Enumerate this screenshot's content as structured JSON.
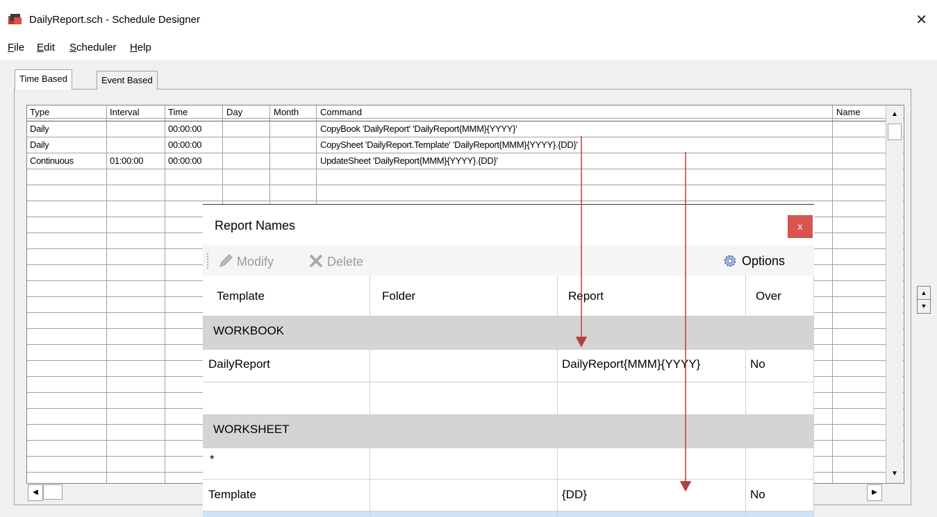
{
  "window": {
    "title": "DailyReport.sch - Schedule Designer",
    "close_glyph": "✕"
  },
  "menu": [
    {
      "label_first": "F",
      "label_rest": "ile"
    },
    {
      "label_first": "E",
      "label_rest": "dit"
    },
    {
      "label_first": "S",
      "label_rest": "cheduler"
    },
    {
      "label_first": "H",
      "label_rest": "elp"
    }
  ],
  "tabs": [
    {
      "label": "Time Based"
    },
    {
      "label": "Event Based"
    }
  ],
  "grid": {
    "columns": [
      "Type",
      "Interval",
      "Time",
      "Day",
      "Month",
      "Command",
      "Name"
    ],
    "rows": [
      {
        "type": "Daily",
        "interval": "",
        "time": "00:00:00",
        "day": "",
        "month": "",
        "command": "CopyBook 'DailyReport' 'DailyReport{MMM}{YYYY}'",
        "name": ""
      },
      {
        "type": "Daily",
        "interval": "",
        "time": "00:00:00",
        "day": "",
        "month": "",
        "command": "CopySheet 'DailyReport.Template' 'DailyReport{MMM}{YYYY}.{DD}'",
        "name": ""
      },
      {
        "type": "Continuous",
        "interval": "01:00:00",
        "time": "00:00:00",
        "day": "",
        "month": "",
        "command": "UpdateSheet 'DailyReport{MMM}{YYYY}.{DD}'",
        "name": ""
      }
    ]
  },
  "dialog": {
    "title": "Report Names",
    "close_label": "x",
    "toolbar": {
      "modify": "Modify",
      "delete": "Delete",
      "options": "Options"
    },
    "columns": [
      "Template",
      "Folder",
      "Report",
      "Over"
    ],
    "rows": [
      {
        "kind": "group",
        "template": "WORKBOOK"
      },
      {
        "kind": "data",
        "template": "DailyReport",
        "folder": "",
        "report": "DailyReport{MMM}{YYYY}",
        "over": "No"
      },
      {
        "kind": "data",
        "template": "",
        "folder": "",
        "report": "",
        "over": ""
      },
      {
        "kind": "group",
        "template": "WORKSHEET"
      },
      {
        "kind": "data",
        "template": "*",
        "folder": "",
        "report": "",
        "over": ""
      },
      {
        "kind": "data",
        "template": "Template",
        "folder": "",
        "report": "{DD}",
        "over": "No"
      }
    ]
  },
  "colors": {
    "arrow": "#b0413e",
    "group_row": "#d4d4d4",
    "close_btn": "#d9534f",
    "selection": "#cfe2f7"
  },
  "icons": [
    "app-icon",
    "close-icon",
    "pencil-icon",
    "delete-x-icon",
    "gear-icon"
  ]
}
